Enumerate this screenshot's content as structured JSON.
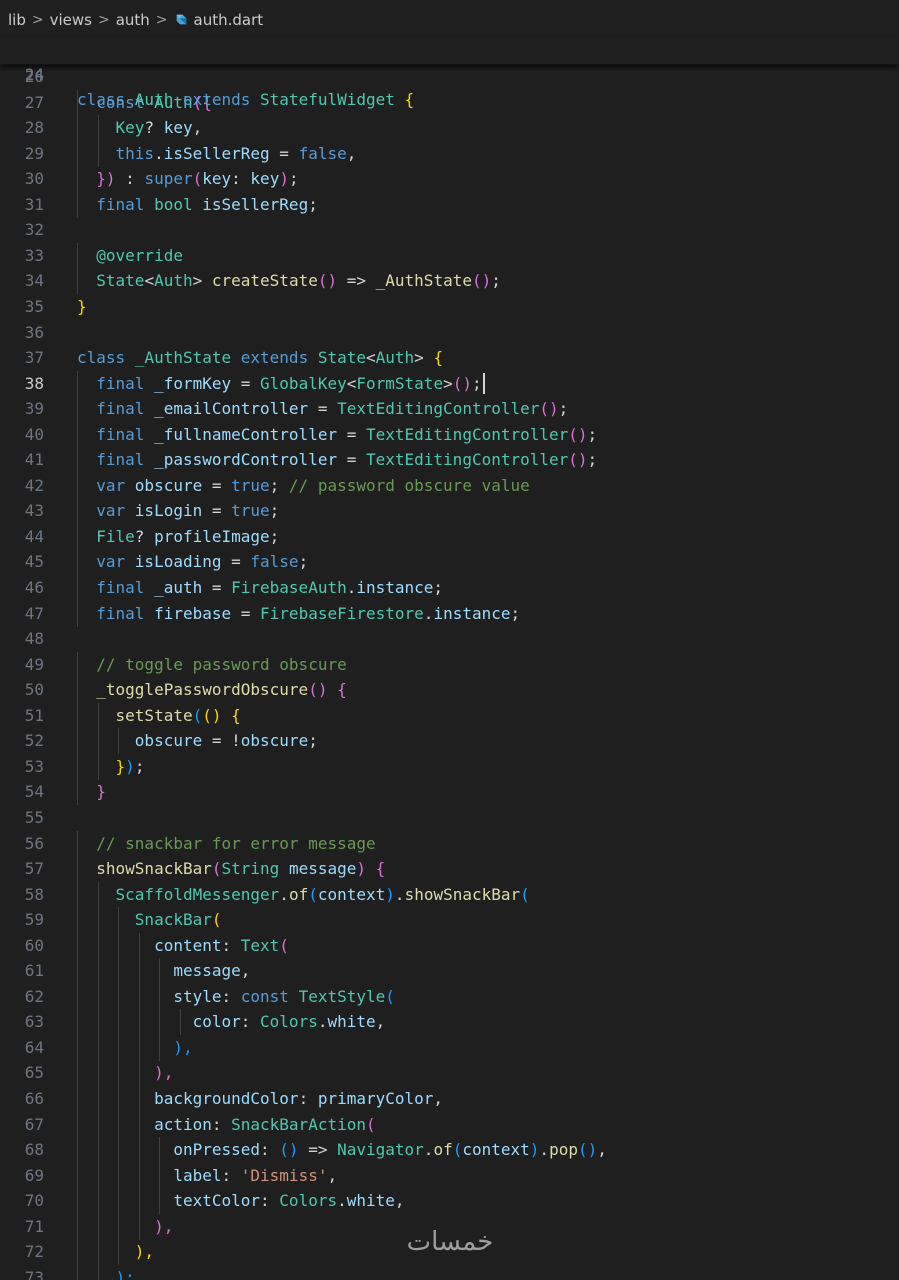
{
  "breadcrumb": {
    "items": [
      "lib",
      "views",
      "auth"
    ],
    "file": "auth.dart",
    "file_icon": "dart-icon"
  },
  "sticky_line": {
    "number": "24",
    "tokens": [
      [
        "kw",
        "class "
      ],
      [
        "ty",
        "Auth "
      ],
      [
        "kw",
        "extends "
      ],
      [
        "ty",
        "StatefulWidget "
      ],
      [
        "b1",
        "{"
      ]
    ]
  },
  "active_line": "38",
  "lines": [
    {
      "n": "26",
      "t": []
    },
    {
      "n": "27",
      "t": [
        [
          "pl",
          "  "
        ],
        [
          "kw",
          "const "
        ],
        [
          "ty",
          "Auth"
        ],
        [
          "b2",
          "({"
        ]
      ]
    },
    {
      "n": "28",
      "t": [
        [
          "pl",
          "    "
        ],
        [
          "ty",
          "Key"
        ],
        [
          "pl",
          "? "
        ],
        [
          "vr",
          "key"
        ],
        [
          "pl",
          ","
        ]
      ]
    },
    {
      "n": "29",
      "t": [
        [
          "pl",
          "    "
        ],
        [
          "kw",
          "this"
        ],
        [
          "pl",
          "."
        ],
        [
          "vr",
          "isSellerReg "
        ],
        [
          "pl",
          "= "
        ],
        [
          "kw",
          "false"
        ],
        [
          "pl",
          ","
        ]
      ]
    },
    {
      "n": "30",
      "t": [
        [
          "pl",
          "  "
        ],
        [
          "b2",
          "})"
        ],
        [
          "pl",
          " : "
        ],
        [
          "kw",
          "super"
        ],
        [
          "b2",
          "("
        ],
        [
          "vr",
          "key"
        ],
        [
          "pl",
          ": "
        ],
        [
          "vr",
          "key"
        ],
        [
          "b2",
          ")"
        ],
        [
          "pl",
          ";"
        ]
      ]
    },
    {
      "n": "31",
      "t": [
        [
          "pl",
          "  "
        ],
        [
          "kw",
          "final "
        ],
        [
          "ty",
          "bool "
        ],
        [
          "vr",
          "isSellerReg"
        ],
        [
          "pl",
          ";"
        ]
      ]
    },
    {
      "n": "32",
      "t": []
    },
    {
      "n": "33",
      "t": [
        [
          "pl",
          "  "
        ],
        [
          "ty",
          "@override"
        ]
      ]
    },
    {
      "n": "34",
      "t": [
        [
          "pl",
          "  "
        ],
        [
          "ty",
          "State"
        ],
        [
          "pl",
          "<"
        ],
        [
          "ty",
          "Auth"
        ],
        [
          "pl",
          "> "
        ],
        [
          "fn",
          "createState"
        ],
        [
          "b2",
          "()"
        ],
        [
          "pl",
          " => "
        ],
        [
          "fn",
          "_AuthState"
        ],
        [
          "b2",
          "()"
        ],
        [
          "pl",
          ";"
        ]
      ]
    },
    {
      "n": "35",
      "t": [
        [
          "b1",
          "}"
        ]
      ]
    },
    {
      "n": "36",
      "t": []
    },
    {
      "n": "37",
      "t": [
        [
          "kw",
          "class "
        ],
        [
          "ty",
          "_AuthState "
        ],
        [
          "kw",
          "extends "
        ],
        [
          "ty",
          "State"
        ],
        [
          "pl",
          "<"
        ],
        [
          "ty",
          "Auth"
        ],
        [
          "pl",
          "> "
        ],
        [
          "b1",
          "{"
        ]
      ]
    },
    {
      "n": "38",
      "t": [
        [
          "pl",
          "  "
        ],
        [
          "kw",
          "final "
        ],
        [
          "vr",
          "_formKey "
        ],
        [
          "pl",
          "= "
        ],
        [
          "ty",
          "GlobalKey"
        ],
        [
          "pl",
          "<"
        ],
        [
          "ty",
          "FormState"
        ],
        [
          "pl",
          ">"
        ],
        [
          "b2",
          "()"
        ],
        [
          "pl",
          ";"
        ]
      ]
    },
    {
      "n": "39",
      "t": [
        [
          "pl",
          "  "
        ],
        [
          "kw",
          "final "
        ],
        [
          "vr",
          "_emailController "
        ],
        [
          "pl",
          "= "
        ],
        [
          "ty",
          "TextEditingController"
        ],
        [
          "b2",
          "()"
        ],
        [
          "pl",
          ";"
        ]
      ]
    },
    {
      "n": "40",
      "t": [
        [
          "pl",
          "  "
        ],
        [
          "kw",
          "final "
        ],
        [
          "vr",
          "_fullnameController "
        ],
        [
          "pl",
          "= "
        ],
        [
          "ty",
          "TextEditingController"
        ],
        [
          "b2",
          "()"
        ],
        [
          "pl",
          ";"
        ]
      ]
    },
    {
      "n": "41",
      "t": [
        [
          "pl",
          "  "
        ],
        [
          "kw",
          "final "
        ],
        [
          "vr",
          "_passwordController "
        ],
        [
          "pl",
          "= "
        ],
        [
          "ty",
          "TextEditingController"
        ],
        [
          "b2",
          "()"
        ],
        [
          "pl",
          ";"
        ]
      ]
    },
    {
      "n": "42",
      "t": [
        [
          "pl",
          "  "
        ],
        [
          "kw",
          "var "
        ],
        [
          "vr",
          "obscure "
        ],
        [
          "pl",
          "= "
        ],
        [
          "kw",
          "true"
        ],
        [
          "pl",
          "; "
        ],
        [
          "cm",
          "// password obscure value"
        ]
      ]
    },
    {
      "n": "43",
      "t": [
        [
          "pl",
          "  "
        ],
        [
          "kw",
          "var "
        ],
        [
          "vr",
          "isLogin "
        ],
        [
          "pl",
          "= "
        ],
        [
          "kw",
          "true"
        ],
        [
          "pl",
          ";"
        ]
      ]
    },
    {
      "n": "44",
      "t": [
        [
          "pl",
          "  "
        ],
        [
          "ty",
          "File"
        ],
        [
          "pl",
          "? "
        ],
        [
          "vr",
          "profileImage"
        ],
        [
          "pl",
          ";"
        ]
      ]
    },
    {
      "n": "45",
      "t": [
        [
          "pl",
          "  "
        ],
        [
          "kw",
          "var "
        ],
        [
          "vr",
          "isLoading "
        ],
        [
          "pl",
          "= "
        ],
        [
          "kw",
          "false"
        ],
        [
          "pl",
          ";"
        ]
      ]
    },
    {
      "n": "46",
      "t": [
        [
          "pl",
          "  "
        ],
        [
          "kw",
          "final "
        ],
        [
          "vr",
          "_auth "
        ],
        [
          "pl",
          "= "
        ],
        [
          "ty",
          "FirebaseAuth"
        ],
        [
          "pl",
          "."
        ],
        [
          "vr",
          "instance"
        ],
        [
          "pl",
          ";"
        ]
      ]
    },
    {
      "n": "47",
      "t": [
        [
          "pl",
          "  "
        ],
        [
          "kw",
          "final "
        ],
        [
          "vr",
          "firebase "
        ],
        [
          "pl",
          "= "
        ],
        [
          "ty",
          "FirebaseFirestore"
        ],
        [
          "pl",
          "."
        ],
        [
          "vr",
          "instance"
        ],
        [
          "pl",
          ";"
        ]
      ]
    },
    {
      "n": "48",
      "t": []
    },
    {
      "n": "49",
      "t": [
        [
          "pl",
          "  "
        ],
        [
          "cm",
          "// toggle password obscure"
        ]
      ]
    },
    {
      "n": "50",
      "t": [
        [
          "pl",
          "  "
        ],
        [
          "fn",
          "_togglePasswordObscure"
        ],
        [
          "b2",
          "()"
        ],
        [
          "pl",
          " "
        ],
        [
          "b2",
          "{"
        ]
      ]
    },
    {
      "n": "51",
      "t": [
        [
          "pl",
          "    "
        ],
        [
          "fn",
          "setState"
        ],
        [
          "b3",
          "("
        ],
        [
          "b1",
          "()"
        ],
        [
          "pl",
          " "
        ],
        [
          "b1",
          "{"
        ]
      ]
    },
    {
      "n": "52",
      "t": [
        [
          "pl",
          "      "
        ],
        [
          "vr",
          "obscure "
        ],
        [
          "pl",
          "= !"
        ],
        [
          "vr",
          "obscure"
        ],
        [
          "pl",
          ";"
        ]
      ]
    },
    {
      "n": "53",
      "t": [
        [
          "pl",
          "    "
        ],
        [
          "b1",
          "}"
        ],
        [
          "b3",
          ")"
        ],
        [
          "pl",
          ";"
        ]
      ]
    },
    {
      "n": "54",
      "t": [
        [
          "pl",
          "  "
        ],
        [
          "b2",
          "}"
        ]
      ]
    },
    {
      "n": "55",
      "t": []
    },
    {
      "n": "56",
      "t": [
        [
          "pl",
          "  "
        ],
        [
          "cm",
          "// snackbar for error message"
        ]
      ]
    },
    {
      "n": "57",
      "t": [
        [
          "pl",
          "  "
        ],
        [
          "fn",
          "showSnackBar"
        ],
        [
          "b2",
          "("
        ],
        [
          "ty",
          "String "
        ],
        [
          "vr",
          "message"
        ],
        [
          "b2",
          ")"
        ],
        [
          "pl",
          " "
        ],
        [
          "b2",
          "{"
        ]
      ]
    },
    {
      "n": "58",
      "t": [
        [
          "pl",
          "    "
        ],
        [
          "ty",
          "ScaffoldMessenger"
        ],
        [
          "pl",
          "."
        ],
        [
          "fn",
          "of"
        ],
        [
          "b3",
          "("
        ],
        [
          "vr",
          "context"
        ],
        [
          "b3",
          ")"
        ],
        [
          "pl",
          "."
        ],
        [
          "fn",
          "showSnackBar"
        ],
        [
          "b3",
          "("
        ]
      ]
    },
    {
      "n": "59",
      "t": [
        [
          "pl",
          "      "
        ],
        [
          "ty",
          "SnackBar"
        ],
        [
          "b1",
          "("
        ]
      ]
    },
    {
      "n": "60",
      "t": [
        [
          "pl",
          "        "
        ],
        [
          "vr",
          "content"
        ],
        [
          "pl",
          ": "
        ],
        [
          "ty",
          "Text"
        ],
        [
          "b2",
          "("
        ]
      ]
    },
    {
      "n": "61",
      "t": [
        [
          "pl",
          "          "
        ],
        [
          "vr",
          "message"
        ],
        [
          "pl",
          ","
        ]
      ]
    },
    {
      "n": "62",
      "t": [
        [
          "pl",
          "          "
        ],
        [
          "vr",
          "style"
        ],
        [
          "pl",
          ": "
        ],
        [
          "kw",
          "const "
        ],
        [
          "ty",
          "TextStyle"
        ],
        [
          "b3",
          "("
        ]
      ]
    },
    {
      "n": "63",
      "t": [
        [
          "pl",
          "            "
        ],
        [
          "vr",
          "color"
        ],
        [
          "pl",
          ": "
        ],
        [
          "ty",
          "Colors"
        ],
        [
          "pl",
          "."
        ],
        [
          "vr",
          "white"
        ],
        [
          "pl",
          ","
        ]
      ]
    },
    {
      "n": "64",
      "t": [
        [
          "pl",
          "          "
        ],
        [
          "b3",
          "),"
        ]
      ]
    },
    {
      "n": "65",
      "t": [
        [
          "pl",
          "        "
        ],
        [
          "b2",
          "),"
        ]
      ]
    },
    {
      "n": "66",
      "t": [
        [
          "pl",
          "        "
        ],
        [
          "vr",
          "backgroundColor"
        ],
        [
          "pl",
          ": "
        ],
        [
          "vr",
          "primaryColor"
        ],
        [
          "pl",
          ","
        ]
      ]
    },
    {
      "n": "67",
      "t": [
        [
          "pl",
          "        "
        ],
        [
          "vr",
          "action"
        ],
        [
          "pl",
          ": "
        ],
        [
          "ty",
          "SnackBarAction"
        ],
        [
          "b2",
          "("
        ]
      ]
    },
    {
      "n": "68",
      "t": [
        [
          "pl",
          "          "
        ],
        [
          "vr",
          "onPressed"
        ],
        [
          "pl",
          ": "
        ],
        [
          "b3",
          "()"
        ],
        [
          "pl",
          " => "
        ],
        [
          "ty",
          "Navigator"
        ],
        [
          "pl",
          "."
        ],
        [
          "fn",
          "of"
        ],
        [
          "b3",
          "("
        ],
        [
          "vr",
          "context"
        ],
        [
          "b3",
          ")"
        ],
        [
          "pl",
          "."
        ],
        [
          "fn",
          "pop"
        ],
        [
          "b3",
          "()"
        ],
        [
          "pl",
          ","
        ]
      ]
    },
    {
      "n": "69",
      "t": [
        [
          "pl",
          "          "
        ],
        [
          "vr",
          "label"
        ],
        [
          "pl",
          ": "
        ],
        [
          "st",
          "'Dismiss'"
        ],
        [
          "pl",
          ","
        ]
      ]
    },
    {
      "n": "70",
      "t": [
        [
          "pl",
          "          "
        ],
        [
          "vr",
          "textColor"
        ],
        [
          "pl",
          ": "
        ],
        [
          "ty",
          "Colors"
        ],
        [
          "pl",
          "."
        ],
        [
          "vr",
          "white"
        ],
        [
          "pl",
          ","
        ]
      ]
    },
    {
      "n": "71",
      "t": [
        [
          "pl",
          "        "
        ],
        [
          "b2",
          "),"
        ]
      ]
    },
    {
      "n": "72",
      "t": [
        [
          "pl",
          "      "
        ],
        [
          "b1",
          "),"
        ]
      ]
    },
    {
      "n": "73",
      "t": [
        [
          "pl",
          "    "
        ],
        [
          "b3",
          ");"
        ]
      ]
    }
  ],
  "watermark": {
    "name": "watermark-logo",
    "text": "خمسات"
  }
}
